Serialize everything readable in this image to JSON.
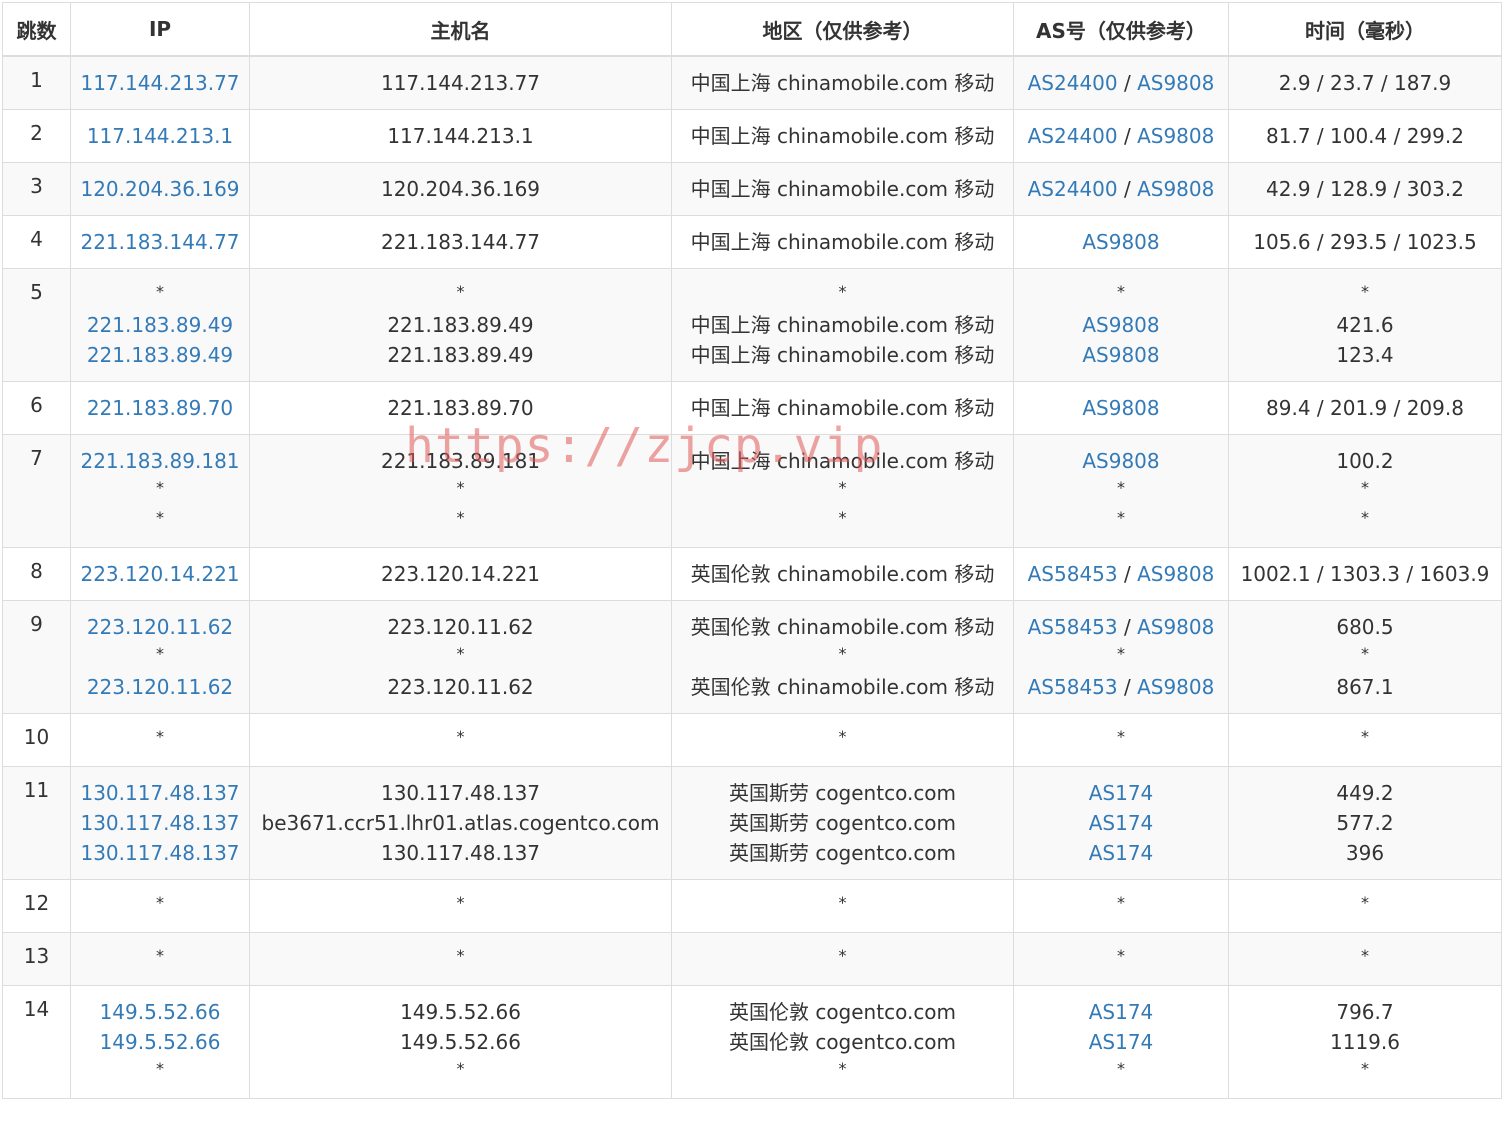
{
  "table": {
    "headers": [
      "跳数",
      "IP",
      "主机名",
      "地区（仅供参考）",
      "AS号（仅供参考）",
      "时间（毫秒）"
    ],
    "rows": [
      {
        "hop": "1",
        "entries": [
          {
            "ip": "117.144.213.77",
            "host": "117.144.213.77",
            "region": "中国上海 chinamobile.com 移动",
            "as": [
              "AS24400",
              "AS9808"
            ],
            "time": "2.9 / 23.7 / 187.9"
          }
        ]
      },
      {
        "hop": "2",
        "entries": [
          {
            "ip": "117.144.213.1",
            "host": "117.144.213.1",
            "region": "中国上海 chinamobile.com 移动",
            "as": [
              "AS24400",
              "AS9808"
            ],
            "time": "81.7 / 100.4 / 299.2"
          }
        ]
      },
      {
        "hop": "3",
        "entries": [
          {
            "ip": "120.204.36.169",
            "host": "120.204.36.169",
            "region": "中国上海 chinamobile.com 移动",
            "as": [
              "AS24400",
              "AS9808"
            ],
            "time": "42.9 / 128.9 / 303.2"
          }
        ]
      },
      {
        "hop": "4",
        "entries": [
          {
            "ip": "221.183.144.77",
            "host": "221.183.144.77",
            "region": "中国上海 chinamobile.com 移动",
            "as": [
              "AS9808"
            ],
            "time": "105.6 / 293.5 / 1023.5"
          }
        ]
      },
      {
        "hop": "5",
        "entries": [
          {
            "ip": "*",
            "host": "*",
            "region": "*",
            "as": [],
            "time": "*"
          },
          {
            "ip": "221.183.89.49",
            "host": "221.183.89.49",
            "region": "中国上海 chinamobile.com 移动",
            "as": [
              "AS9808"
            ],
            "time": "421.6"
          },
          {
            "ip": "221.183.89.49",
            "host": "221.183.89.49",
            "region": "中国上海 chinamobile.com 移动",
            "as": [
              "AS9808"
            ],
            "time": "123.4"
          }
        ]
      },
      {
        "hop": "6",
        "entries": [
          {
            "ip": "221.183.89.70",
            "host": "221.183.89.70",
            "region": "中国上海 chinamobile.com 移动",
            "as": [
              "AS9808"
            ],
            "time": "89.4 / 201.9 / 209.8"
          }
        ]
      },
      {
        "hop": "7",
        "entries": [
          {
            "ip": "221.183.89.181",
            "host": "221.183.89.181",
            "region": "中国上海 chinamobile.com 移动",
            "as": [
              "AS9808"
            ],
            "time": "100.2"
          },
          {
            "ip": "*",
            "host": "*",
            "region": "*",
            "as": [],
            "time": "*"
          },
          {
            "ip": "*",
            "host": "*",
            "region": "*",
            "as": [],
            "time": "*"
          }
        ]
      },
      {
        "hop": "8",
        "entries": [
          {
            "ip": "223.120.14.221",
            "host": "223.120.14.221",
            "region": "英国伦敦 chinamobile.com 移动",
            "as": [
              "AS58453",
              "AS9808"
            ],
            "time": "1002.1 / 1303.3 / 1603.9"
          }
        ]
      },
      {
        "hop": "9",
        "entries": [
          {
            "ip": "223.120.11.62",
            "host": "223.120.11.62",
            "region": "英国伦敦 chinamobile.com 移动",
            "as": [
              "AS58453",
              "AS9808"
            ],
            "time": "680.5"
          },
          {
            "ip": "*",
            "host": "*",
            "region": "*",
            "as": [],
            "time": "*"
          },
          {
            "ip": "223.120.11.62",
            "host": "223.120.11.62",
            "region": "英国伦敦 chinamobile.com 移动",
            "as": [
              "AS58453",
              "AS9808"
            ],
            "time": "867.1"
          }
        ]
      },
      {
        "hop": "10",
        "entries": [
          {
            "ip": "*",
            "host": "*",
            "region": "*",
            "as": [],
            "time": "*"
          }
        ]
      },
      {
        "hop": "11",
        "entries": [
          {
            "ip": "130.117.48.137",
            "host": "130.117.48.137",
            "region": "英国斯劳 cogentco.com",
            "as": [
              "AS174"
            ],
            "time": "449.2"
          },
          {
            "ip": "130.117.48.137",
            "host": "be3671.ccr51.lhr01.atlas.cogentco.com",
            "region": "英国斯劳 cogentco.com",
            "as": [
              "AS174"
            ],
            "time": "577.2"
          },
          {
            "ip": "130.117.48.137",
            "host": "130.117.48.137",
            "region": "英国斯劳 cogentco.com",
            "as": [
              "AS174"
            ],
            "time": "396"
          }
        ]
      },
      {
        "hop": "12",
        "entries": [
          {
            "ip": "*",
            "host": "*",
            "region": "*",
            "as": [],
            "time": "*"
          }
        ]
      },
      {
        "hop": "13",
        "entries": [
          {
            "ip": "*",
            "host": "*",
            "region": "*",
            "as": [],
            "time": "*"
          }
        ]
      },
      {
        "hop": "14",
        "entries": [
          {
            "ip": "149.5.52.66",
            "host": "149.5.52.66",
            "region": "英国伦敦 cogentco.com",
            "as": [
              "AS174"
            ],
            "time": "796.7"
          },
          {
            "ip": "149.5.52.66",
            "host": "149.5.52.66",
            "region": "英国伦敦 cogentco.com",
            "as": [
              "AS174"
            ],
            "time": "1119.6"
          },
          {
            "ip": "*",
            "host": "*",
            "region": "*",
            "as": [],
            "time": "*"
          }
        ]
      }
    ]
  },
  "watermark": "https://zjcp.vip",
  "colors": {
    "link": "#337ab7",
    "stripe": "#f9f9f9",
    "border": "#dddddd",
    "text": "#333333",
    "watermark": "#e15a5a"
  }
}
